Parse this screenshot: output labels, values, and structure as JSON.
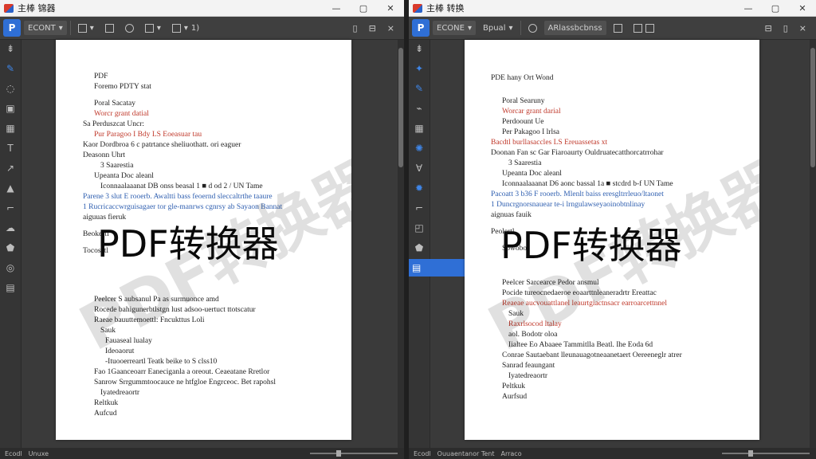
{
  "left": {
    "title": "主棒 锦器",
    "toolbar": {
      "view_select": "ECONT",
      "items": [
        "",
        "",
        "",
        "",
        "1)"
      ],
      "right_icons": [
        "page-icon",
        "lock-icon",
        "close-tab-icon"
      ]
    },
    "doc_lines": [
      "PDF",
      "Foremo PDTY stat",
      "",
      "Poral Sacatay",
      "Worcr grant datial",
      "Sa Perduszcat Uncr:",
      "Pur Paragoo I Bdy  LS  Eoeasuar tau",
      "Kaor  Dordbroa 6 c patrtance sheliuothatt. ori eaguer",
      "Deasonn  Uhrt",
      "3 Saarestia",
      "Upeanta Doc aleanl",
      "Iconnaalaaanat  DB onss beasal 1  ■  d od 2 / UN Tame",
      "Parene 3 slut E rooerb. Awaltti bass feoernd sleccaltrthe  taaure",
      "1 Rucricaccwrguisagaer  tor  gle-manrws cgnrsy ab Sayaon Bannat",
      "aiguuas fieruk",
      "",
      "Beokertl",
      "",
      "Tocosatl",
      "",
      "Peelcer  S  aubsanul  Pa as  surmuonce            amd",
      "Rocede bahigunerbtlstgn  lust  adsoo-uertuct  ttotscatur",
      "Raeae bauuttemoettl:    Fncukttus  Loli",
      "Sauk",
      "Fauaseal  lualay",
      "Ideoaorut",
      "-Ituooerreartl  Teatk beike to  S clss10",
      "Fao  1Gaanceoarr  Eaneciganla a oreout. Ceaeatane  Rretlor",
      "Sanrow  Srrgummtoocauce ne htfgloe Engrceoc. Bet rapohsl",
      "Iyatedreaortr",
      "Reltkuk",
      "Aufcud"
    ],
    "banner": "PDF转换器",
    "watermark": "PDF转换器",
    "status": [
      "Ecodl",
      "Unuxe"
    ]
  },
  "right": {
    "title": "主棒 转换",
    "toolbar": {
      "view_select": "ECONE",
      "items": [
        "Bpual",
        "ARlassbcbnss",
        "",
        "",
        ""
      ],
      "right_icons": [
        "lock-icon",
        "page-icon",
        "close-tab-icon"
      ]
    },
    "doc_lines": [
      "PDE hany Ort Wond",
      "",
      "",
      "Poral Searuny",
      "Worcar grant darial",
      "Perdoount Ue",
      "Per Pakagoo I lrlsa",
      "Bacdtl  burllasaccles  LS  Ereuassetas xt",
      "Doonan  Fan  sc  Gar Fiaroaurty Ouldruatecatthorcatrrohar",
      "3 Saarestia",
      "Upeanta Doc aleanl",
      "Iconnaalaaanat  D6 aonc bassal 1a  ■  stcdrd b-f UN Tame",
      "Pacoatt 3 b36 F rooerb. Mlenlt baiss eresgltrrleuo/ltaonet",
      "1 Duncrgnorsnauear  te-i lrngulawseyaoinobtnlinay",
      "aignuas fauik",
      "",
      "Peolertl",
      "",
      "Sowobot",
      "",
      "Peelcer  Sarcearce Pedor ansmul               ",
      "Pocide  tureocnedaeroe  eoaarttnleaneradrtr  Ereattac",
      "Reaeae  aucvouattlanel  leaurtgiactnsacr  earroarcettnnel",
      "Sauk",
      "Raxrlsocod  ltalay",
      "aol. Bodotr oloa",
      "Iialtee  Eo  Abaaee  Tammitlla Beatl. Ihe Eoda 6d",
      "Conrae  Sautaebant  lleunauagotneaanetaert  Oereeneglr atrer",
      "Sanrad  feaungant",
      "Iyatedreaortr",
      "Peltkuk",
      "Aurfsud"
    ],
    "banner": "PDF转换器",
    "watermark": "PDF转换器",
    "status": [
      "Ecodl",
      "Ouuaentanor Tent",
      "Arraco"
    ]
  }
}
